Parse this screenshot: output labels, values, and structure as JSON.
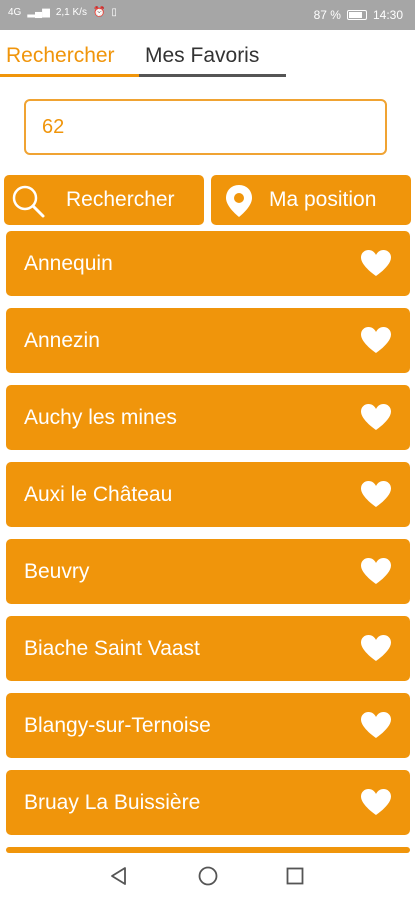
{
  "status_bar": {
    "signal_text": "4G",
    "data_rate": "2,1 K/s",
    "battery_pct": "87 %",
    "time": "14:30"
  },
  "tabs": {
    "search_label": "Rechercher",
    "favorites_label": "Mes Favoris",
    "active": "Rechercher"
  },
  "search": {
    "value": "62"
  },
  "actions": {
    "search_label": "Rechercher",
    "position_label": "Ma position"
  },
  "cities": [
    "Annequin",
    "Annezin",
    "Auchy les mines",
    "Auxi le Château",
    "Beuvry",
    "Biache Saint Vaast",
    "Blangy-sur-Ternoise",
    "Bruay La Buissière"
  ],
  "colors": {
    "accent": "#f0950b",
    "status_bar": "#a6a6a6"
  },
  "icons": {
    "search_button": "search-icon",
    "position_button": "location-pin-icon",
    "favorite": "heart-icon",
    "nav_back": "back-triangle-icon",
    "nav_home": "home-circle-icon",
    "nav_recent": "recent-square-icon"
  }
}
